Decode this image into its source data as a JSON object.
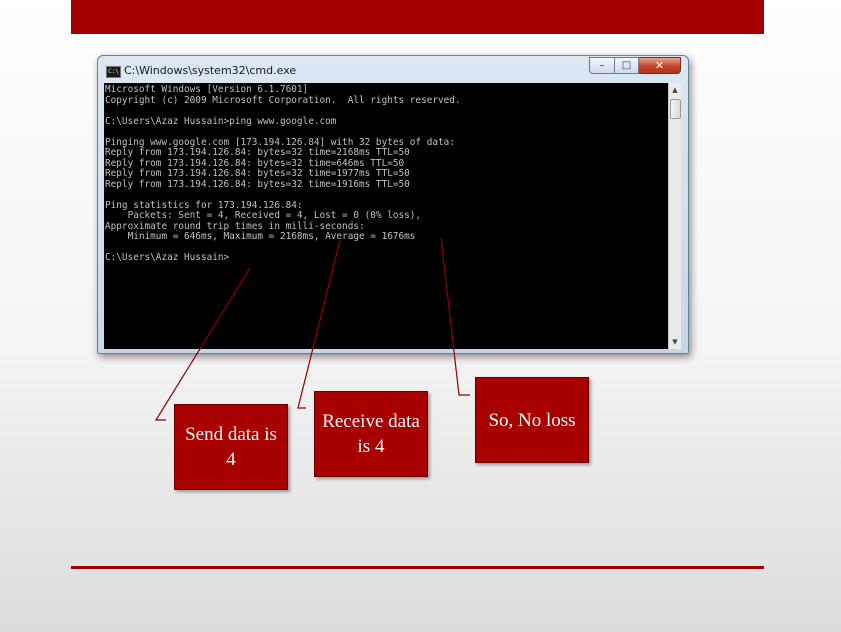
{
  "window": {
    "title": "C:\\Windows\\system32\\cmd.exe",
    "icon": "cmd-icon",
    "buttons": {
      "minimize": "–",
      "maximize": "□",
      "close": "✕"
    }
  },
  "console": {
    "lines": [
      "Microsoft Windows [Version 6.1.7601]",
      "Copyright (c) 2009 Microsoft Corporation.  All rights reserved.",
      "",
      "C:\\Users\\Azaz Hussain>ping www.google.com",
      "",
      "Pinging www.google.com [173.194.126.84] with 32 bytes of data:",
      "Reply from 173.194.126.84: bytes=32 time=2168ms TTL=50",
      "Reply from 173.194.126.84: bytes=32 time=646ms TTL=50",
      "Reply from 173.194.126.84: bytes=32 time=1977ms TTL=50",
      "Reply from 173.194.126.84: bytes=32 time=1916ms TTL=50",
      "",
      "Ping statistics for 173.194.126.84:",
      "    Packets: Sent = 4, Received = 4, Lost = 0 (0% loss),",
      "Approximate round trip times in milli-seconds:",
      "    Minimum = 646ms, Maximum = 2168ms, Average = 1676ms",
      "",
      "C:\\Users\\Azaz Hussain>"
    ],
    "text_color": "#c0c0c0"
  },
  "callouts": {
    "send": "Send data is 4",
    "receive": "Receive data is 4",
    "loss": "So, No loss"
  },
  "colors": {
    "accent": "#a50000",
    "callout_bg": "#a80000",
    "callout_line": "#8b0000"
  }
}
